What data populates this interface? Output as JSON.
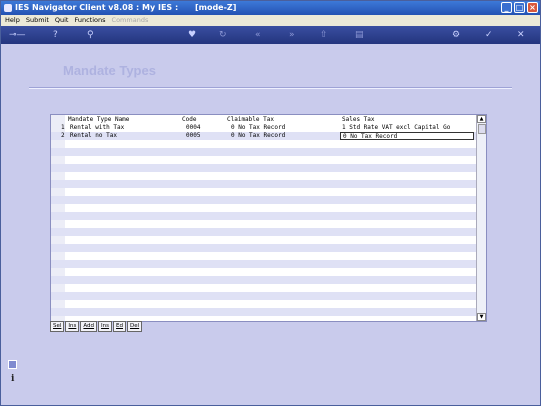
{
  "window": {
    "title": "IES Navigator Client v8.08 : My IES :",
    "mode": "[mode-Z]"
  },
  "menu": {
    "items": [
      "Help",
      "Submit",
      "Quit",
      "Functions"
    ],
    "disabled_item": "Commands"
  },
  "page": {
    "title": "Mandate Types"
  },
  "table": {
    "columns": {
      "name": "Mandate Type Name",
      "code": "Code",
      "claimable_tax": "Claimable Tax",
      "sales_tax": "Sales Tax"
    },
    "rows": [
      {
        "num": "1",
        "name": "Rental with Tax",
        "code": "0004",
        "claimable_tax": "0 No Tax Record",
        "sales_tax": "1 Std Rate VAT excl Capital Go"
      },
      {
        "num": "2",
        "name": "Rental no Tax",
        "code": "0005",
        "claimable_tax": "0 No Tax Record",
        "sales_tax": "0 No Tax Record"
      }
    ]
  },
  "grid_buttons": [
    "Sel",
    "Ins",
    "Add",
    "Ins",
    "Ed",
    "Del"
  ],
  "colors": {
    "titlebar": "#2f66c8",
    "toolbar": "#2c3f8c",
    "background": "#c9cbec",
    "stripe": "#dfe1f5"
  }
}
